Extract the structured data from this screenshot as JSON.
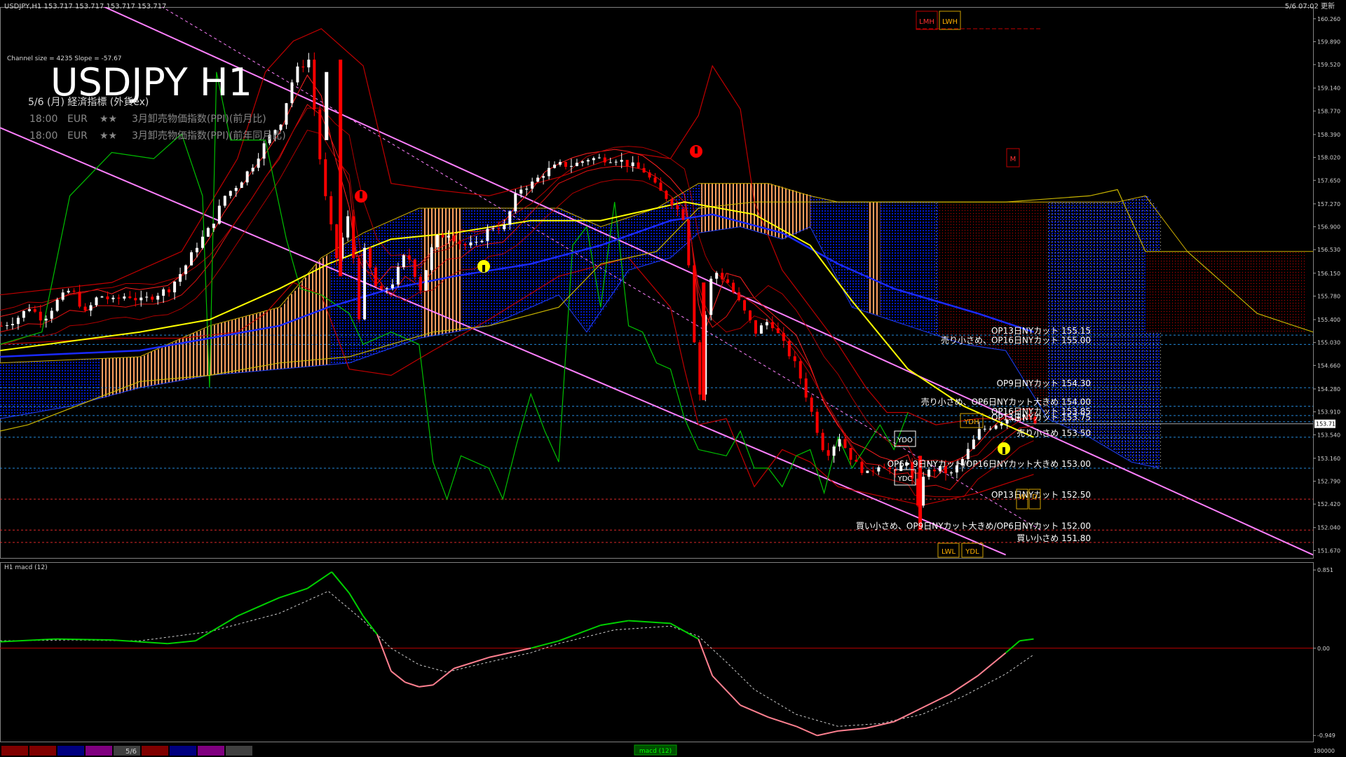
{
  "window": {
    "symbol_header": "USDJPY,H1  153.717 153.717 153.717 153.717",
    "updated": "5/6 07:02 更新"
  },
  "overlay": {
    "channel_info": "Channel size = 4235 Slope = -57.67",
    "title": "USDJPY H1",
    "event_date": "5/6 (月) 経済指標 (外貨ex)",
    "events": [
      {
        "time": "18:00",
        "currency": "EUR",
        "stars": "★★",
        "name": "3月卸売物価指数(PPI)(前月比)"
      },
      {
        "time": "18:00",
        "currency": "EUR",
        "stars": "★★",
        "name": "3月卸売物価指数(PPI)(前年同月比)"
      }
    ]
  },
  "markers": {
    "lmh": "LMH",
    "lwh": "LWH",
    "m": "M",
    "ydh": "YDH",
    "ydo": "YDO",
    "ydc": "YDC",
    "lwl": "LWL",
    "ydl": "YDL",
    "w": "W",
    "d": "D"
  },
  "price_axis": {
    "ticks": [
      "160.260",
      "159.890",
      "159.520",
      "159.140",
      "158.770",
      "158.390",
      "158.020",
      "157.650",
      "157.270",
      "156.900",
      "156.530",
      "156.150",
      "155.780",
      "155.400",
      "155.030",
      "154.660",
      "154.280",
      "153.910",
      "153.540",
      "153.160",
      "152.790",
      "152.420",
      "152.040",
      "151.670"
    ],
    "current": "153.717"
  },
  "levels": [
    {
      "price": 155.15,
      "label": "OP13日NYカット 155.15",
      "color": "#2aa0ff"
    },
    {
      "price": 155.0,
      "label": "売り小さめ、OP16日NYカット 155.00",
      "color": "#2aa0ff"
    },
    {
      "price": 154.3,
      "label": "OP9日NYカット 154.30",
      "color": "#2aa0ff"
    },
    {
      "price": 154.0,
      "label": "売り小さめ、OP6日NYカット大きめ 154.00",
      "color": "#2aa0ff"
    },
    {
      "price": 153.85,
      "label": "OP16日NYカット 153.85",
      "color": "#2aa0ff"
    },
    {
      "price": 153.75,
      "label": "OP13日NYカット 153.75",
      "color": "#2aa0ff"
    },
    {
      "price": 153.5,
      "label": "売り小さめ 153.50",
      "color": "#2aa0ff"
    },
    {
      "price": 153.0,
      "label": "OP6・9日NYカット/OP16日NYカット大きめ 153.00",
      "color": "#2aa0ff"
    },
    {
      "price": 152.5,
      "label": "OP13日NYカット 152.50",
      "color": "#ff3030"
    },
    {
      "price": 152.0,
      "label": "買い小さめ、OP9日NYカット大きめ/OP6日NYカット 152.00",
      "color": "#ff3030"
    },
    {
      "price": 151.8,
      "label": "買い小さめ 151.80",
      "color": "#ff3030"
    }
  ],
  "macd": {
    "label": "H1  macd (12)",
    "ticks": [
      "0.851",
      "0.00",
      "-0.949"
    ],
    "tab": "macd (12)"
  },
  "bottom_bar": {
    "date": "5/6",
    "right_value": "180000",
    "swatches": [
      "#800000",
      "#800000",
      "#000080",
      "#800080",
      "#404040",
      "#800000",
      "#000080",
      "#800080",
      "#404040"
    ]
  },
  "colors": {
    "bull": "#ffffff",
    "bear": "#ff0000",
    "ma_yellow": "#ffff00",
    "ma_blue": "#1a2aff",
    "bb_red": "#c00000",
    "tenkan": "#00c000",
    "kumo_blue": "#0000c0",
    "kumo_orange": "#ffb070",
    "channel": "#ff80ff",
    "macd": "#00d000",
    "macd_neg": "#ff8090",
    "signal": "#cccccc"
  },
  "chart_data": {
    "type": "candlestick",
    "title": "USDJPY H1",
    "ylim": [
      151.55,
      160.45
    ],
    "close_path": [
      [
        0,
        155.3
      ],
      [
        20,
        155.4
      ],
      [
        40,
        155.6
      ],
      [
        60,
        155.4
      ],
      [
        80,
        155.7
      ],
      [
        100,
        155.9
      ],
      [
        120,
        155.5
      ],
      [
        140,
        155.8
      ],
      [
        160,
        155.7
      ],
      [
        180,
        155.8
      ],
      [
        200,
        155.7
      ],
      [
        220,
        155.8
      ],
      [
        240,
        155.9
      ],
      [
        260,
        156.2
      ],
      [
        280,
        156.6
      ],
      [
        300,
        156.9
      ],
      [
        320,
        157.4
      ],
      [
        340,
        157.6
      ],
      [
        360,
        157.9
      ],
      [
        380,
        158.3
      ],
      [
        400,
        158.6
      ],
      [
        420,
        159.4
      ],
      [
        440,
        159.6
      ],
      [
        460,
        157.6
      ],
      [
        480,
        156.4
      ],
      [
        500,
        157.2
      ],
      [
        510,
        155.2
      ],
      [
        520,
        156.5
      ],
      [
        540,
        155.8
      ],
      [
        560,
        156.0
      ],
      [
        580,
        156.5
      ],
      [
        600,
        155.9
      ],
      [
        620,
        156.7
      ],
      [
        640,
        156.8
      ],
      [
        660,
        156.6
      ],
      [
        680,
        156.6
      ],
      [
        700,
        156.9
      ],
      [
        720,
        156.9
      ],
      [
        740,
        157.5
      ],
      [
        760,
        157.6
      ],
      [
        780,
        157.8
      ],
      [
        800,
        157.9
      ],
      [
        820,
        157.9
      ],
      [
        840,
        158.0
      ],
      [
        860,
        158.0
      ],
      [
        880,
        158.0
      ],
      [
        900,
        157.9
      ],
      [
        920,
        157.8
      ],
      [
        940,
        157.5
      ],
      [
        960,
        157.3
      ],
      [
        980,
        157.0
      ],
      [
        990,
        155.3
      ],
      [
        1000,
        154.2
      ],
      [
        1010,
        155.8
      ],
      [
        1020,
        156.2
      ],
      [
        1040,
        156.0
      ],
      [
        1060,
        155.6
      ],
      [
        1080,
        155.2
      ],
      [
        1100,
        155.4
      ],
      [
        1120,
        155.0
      ],
      [
        1140,
        154.6
      ],
      [
        1160,
        153.9
      ],
      [
        1180,
        153.2
      ],
      [
        1200,
        153.5
      ],
      [
        1220,
        153.1
      ],
      [
        1240,
        152.9
      ],
      [
        1260,
        153.1
      ],
      [
        1280,
        152.9
      ],
      [
        1300,
        153.2
      ],
      [
        1310,
        152.2
      ],
      [
        1320,
        152.9
      ],
      [
        1340,
        153.0
      ],
      [
        1360,
        152.9
      ],
      [
        1380,
        153.2
      ],
      [
        1400,
        153.6
      ],
      [
        1420,
        153.7
      ],
      [
        1440,
        153.8
      ],
      [
        1460,
        153.9
      ],
      [
        1480,
        153.72
      ]
    ],
    "ma_yellow": [
      [
        0,
        154.9
      ],
      [
        200,
        155.2
      ],
      [
        300,
        155.4
      ],
      [
        400,
        155.9
      ],
      [
        470,
        156.3
      ],
      [
        560,
        156.7
      ],
      [
        650,
        156.8
      ],
      [
        760,
        157.0
      ],
      [
        860,
        157.0
      ],
      [
        980,
        157.3
      ],
      [
        1080,
        157.1
      ],
      [
        1160,
        156.6
      ],
      [
        1220,
        155.7
      ],
      [
        1300,
        154.6
      ],
      [
        1380,
        154.0
      ],
      [
        1440,
        153.7
      ],
      [
        1480,
        153.5
      ]
    ],
    "ma_blue": [
      [
        0,
        154.8
      ],
      [
        200,
        154.9
      ],
      [
        300,
        155.1
      ],
      [
        400,
        155.3
      ],
      [
        470,
        155.6
      ],
      [
        560,
        155.9
      ],
      [
        650,
        156.1
      ],
      [
        760,
        156.3
      ],
      [
        860,
        156.6
      ],
      [
        960,
        157.0
      ],
      [
        1020,
        157.1
      ],
      [
        1120,
        156.8
      ],
      [
        1200,
        156.3
      ],
      [
        1280,
        155.9
      ],
      [
        1340,
        155.7
      ],
      [
        1400,
        155.5
      ],
      [
        1480,
        155.2
      ]
    ],
    "tenkan": [
      [
        0,
        155.0
      ],
      [
        60,
        155.2
      ],
      [
        100,
        157.4
      ],
      [
        160,
        158.1
      ],
      [
        220,
        158.0
      ],
      [
        260,
        158.4
      ],
      [
        290,
        157.4
      ],
      [
        300,
        154.3
      ],
      [
        310,
        159.4
      ],
      [
        330,
        158.3
      ],
      [
        380,
        158.3
      ],
      [
        410,
        156.7
      ],
      [
        430,
        155.9
      ],
      [
        460,
        155.8
      ],
      [
        500,
        155.5
      ],
      [
        520,
        155.0
      ],
      [
        560,
        155.2
      ],
      [
        600,
        155.0
      ],
      [
        620,
        153.1
      ],
      [
        640,
        152.5
      ],
      [
        660,
        153.2
      ],
      [
        700,
        153.0
      ],
      [
        720,
        152.5
      ],
      [
        740,
        153.4
      ],
      [
        760,
        154.2
      ],
      [
        780,
        153.6
      ],
      [
        800,
        153.1
      ],
      [
        820,
        156.6
      ],
      [
        840,
        156.9
      ],
      [
        860,
        155.6
      ],
      [
        880,
        157.3
      ],
      [
        900,
        155.3
      ],
      [
        920,
        155.2
      ],
      [
        940,
        154.7
      ],
      [
        960,
        154.6
      ],
      [
        980,
        153.8
      ],
      [
        1000,
        153.3
      ],
      [
        1040,
        153.2
      ],
      [
        1060,
        153.6
      ],
      [
        1080,
        153.0
      ],
      [
        1100,
        153.0
      ],
      [
        1120,
        152.7
      ],
      [
        1140,
        153.2
      ],
      [
        1160,
        153.3
      ],
      [
        1180,
        152.6
      ],
      [
        1200,
        153.5
      ],
      [
        1220,
        153.0
      ],
      [
        1260,
        153.7
      ],
      [
        1280,
        153.3
      ],
      [
        1300,
        153.9
      ]
    ],
    "kijun": [
      [
        0,
        153.6
      ],
      [
        40,
        153.7
      ],
      [
        200,
        154.4
      ],
      [
        300,
        154.5
      ],
      [
        400,
        154.7
      ],
      [
        500,
        154.8
      ],
      [
        560,
        155.0
      ],
      [
        620,
        155.2
      ],
      [
        700,
        155.3
      ],
      [
        800,
        155.6
      ],
      [
        860,
        156.3
      ],
      [
        940,
        156.5
      ],
      [
        1000,
        157.2
      ],
      [
        1080,
        157.3
      ],
      [
        1160,
        157.3
      ],
      [
        1240,
        157.3
      ],
      [
        1320,
        157.3
      ],
      [
        1380,
        157.3
      ],
      [
        1440,
        157.3
      ],
      [
        1560,
        157.4
      ],
      [
        1600,
        157.5
      ],
      [
        1640,
        156.5
      ],
      [
        1700,
        156.5
      ],
      [
        1800,
        155.5
      ],
      [
        1880,
        155.2
      ]
    ],
    "bollinger_upper": [
      [
        0,
        155.8
      ],
      [
        160,
        156.0
      ],
      [
        260,
        156.5
      ],
      [
        340,
        158.0
      ],
      [
        380,
        159.4
      ],
      [
        420,
        159.9
      ],
      [
        460,
        160.1
      ],
      [
        520,
        159.5
      ],
      [
        560,
        157.6
      ],
      [
        620,
        157.5
      ],
      [
        700,
        157.4
      ],
      [
        800,
        157.7
      ],
      [
        900,
        158.1
      ],
      [
        960,
        158.0
      ],
      [
        1000,
        158.7
      ],
      [
        1020,
        159.5
      ],
      [
        1060,
        158.8
      ],
      [
        1080,
        157.3
      ],
      [
        1120,
        156.2
      ],
      [
        1160,
        155.6
      ],
      [
        1200,
        155.0
      ],
      [
        1240,
        154.3
      ],
      [
        1270,
        153.9
      ],
      [
        1300,
        153.9
      ],
      [
        1340,
        153.7
      ],
      [
        1400,
        153.8
      ],
      [
        1480,
        153.8
      ]
    ],
    "bollinger_lower": [
      [
        0,
        155.0
      ],
      [
        160,
        155.1
      ],
      [
        260,
        155.1
      ],
      [
        340,
        155.2
      ],
      [
        380,
        155.5
      ],
      [
        420,
        156.0
      ],
      [
        460,
        155.8
      ],
      [
        500,
        154.6
      ],
      [
        560,
        154.5
      ],
      [
        620,
        154.9
      ],
      [
        700,
        155.4
      ],
      [
        800,
        156.1
      ],
      [
        900,
        156.4
      ],
      [
        960,
        155.6
      ],
      [
        980,
        154.6
      ],
      [
        1000,
        153.7
      ],
      [
        1040,
        153.8
      ],
      [
        1080,
        152.7
      ],
      [
        1120,
        153.3
      ],
      [
        1160,
        153.1
      ],
      [
        1200,
        152.7
      ],
      [
        1240,
        152.6
      ],
      [
        1280,
        152.5
      ],
      [
        1320,
        152.4
      ],
      [
        1400,
        152.6
      ],
      [
        1480,
        152.9
      ]
    ],
    "cloud_upper": [
      [
        0,
        154.7
      ],
      [
        200,
        154.8
      ],
      [
        260,
        155.1
      ],
      [
        300,
        155.3
      ],
      [
        400,
        155.6
      ],
      [
        460,
        156.4
      ],
      [
        520,
        156.8
      ],
      [
        600,
        157.2
      ],
      [
        700,
        157.2
      ],
      [
        800,
        157.2
      ],
      [
        860,
        156.9
      ],
      [
        940,
        157.2
      ],
      [
        1000,
        157.6
      ],
      [
        1060,
        157.6
      ],
      [
        1100,
        157.6
      ],
      [
        1160,
        157.4
      ],
      [
        1200,
        157.3
      ],
      [
        1320,
        157.3
      ],
      [
        1500,
        157.3
      ],
      [
        1600,
        157.3
      ],
      [
        1640,
        157.4
      ],
      [
        1700,
        156.5
      ],
      [
        1800,
        156.5
      ],
      [
        1880,
        156.5
      ]
    ],
    "cloud_lower": [
      [
        0,
        153.8
      ],
      [
        100,
        154.0
      ],
      [
        200,
        154.3
      ],
      [
        300,
        154.5
      ],
      [
        400,
        154.6
      ],
      [
        500,
        154.7
      ],
      [
        600,
        155.1
      ],
      [
        700,
        155.3
      ],
      [
        760,
        155.6
      ],
      [
        800,
        155.8
      ],
      [
        840,
        155.2
      ],
      [
        900,
        156.2
      ],
      [
        960,
        156.4
      ],
      [
        1000,
        156.8
      ],
      [
        1060,
        156.9
      ],
      [
        1120,
        156.7
      ],
      [
        1160,
        156.9
      ],
      [
        1220,
        155.6
      ],
      [
        1300,
        155.3
      ],
      [
        1380,
        155.0
      ],
      [
        1440,
        154.9
      ],
      [
        1500,
        153.8
      ],
      [
        1560,
        153.5
      ],
      [
        1620,
        153.1
      ],
      [
        1660,
        153.0
      ]
    ],
    "macd_line": [
      [
        0,
        0.07
      ],
      [
        80,
        0.1
      ],
      [
        160,
        0.09
      ],
      [
        240,
        0.05
      ],
      [
        280,
        0.08
      ],
      [
        340,
        0.35
      ],
      [
        400,
        0.55
      ],
      [
        440,
        0.65
      ],
      [
        475,
        0.83
      ],
      [
        500,
        0.6
      ],
      [
        520,
        0.35
      ],
      [
        540,
        0.15
      ],
      [
        560,
        -0.25
      ],
      [
        580,
        -0.37
      ],
      [
        600,
        -0.42
      ],
      [
        620,
        -0.4
      ],
      [
        650,
        -0.22
      ],
      [
        700,
        -0.1
      ],
      [
        760,
        -0.0
      ],
      [
        800,
        0.08
      ],
      [
        860,
        0.25
      ],
      [
        900,
        0.3
      ],
      [
        960,
        0.27
      ],
      [
        1000,
        0.1
      ],
      [
        1020,
        -0.3
      ],
      [
        1060,
        -0.62
      ],
      [
        1100,
        -0.75
      ],
      [
        1140,
        -0.85
      ],
      [
        1170,
        -0.95
      ],
      [
        1200,
        -0.9
      ],
      [
        1240,
        -0.87
      ],
      [
        1280,
        -0.8
      ],
      [
        1320,
        -0.65
      ],
      [
        1360,
        -0.5
      ],
      [
        1400,
        -0.3
      ],
      [
        1440,
        -0.05
      ],
      [
        1460,
        0.08
      ],
      [
        1480,
        0.1
      ]
    ],
    "macd_signal": [
      [
        0,
        0.08
      ],
      [
        100,
        0.09
      ],
      [
        200,
        0.08
      ],
      [
        300,
        0.18
      ],
      [
        400,
        0.38
      ],
      [
        470,
        0.62
      ],
      [
        520,
        0.3
      ],
      [
        560,
        0.0
      ],
      [
        600,
        -0.18
      ],
      [
        640,
        -0.26
      ],
      [
        700,
        -0.15
      ],
      [
        760,
        -0.05
      ],
      [
        800,
        0.05
      ],
      [
        880,
        0.2
      ],
      [
        960,
        0.24
      ],
      [
        1000,
        0.13
      ],
      [
        1040,
        -0.15
      ],
      [
        1080,
        -0.45
      ],
      [
        1140,
        -0.72
      ],
      [
        1200,
        -0.85
      ],
      [
        1260,
        -0.82
      ],
      [
        1320,
        -0.72
      ],
      [
        1380,
        -0.52
      ],
      [
        1440,
        -0.28
      ],
      [
        1480,
        -0.07
      ]
    ],
    "macd_ylim": [
      -0.97,
      0.86
    ]
  }
}
